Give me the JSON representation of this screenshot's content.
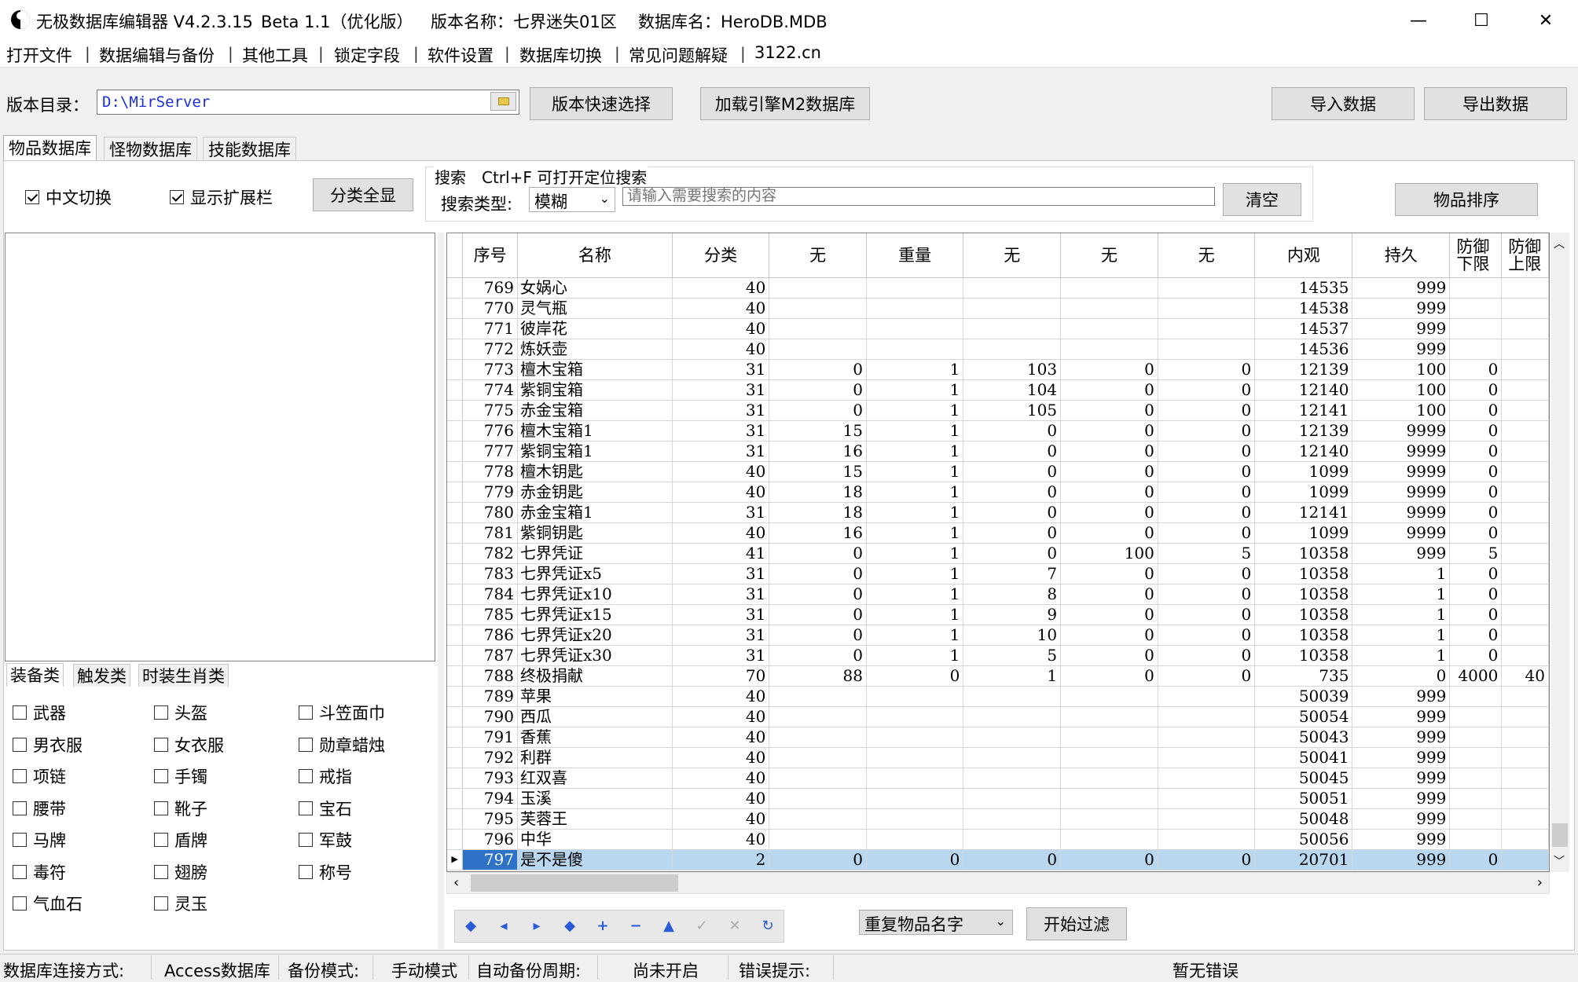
{
  "window": {
    "title": "无极数据库编辑器 V4.2.3.15",
    "beta": "Beta 1.1（优化版）",
    "version_name": "版本名称：七界迷失01区",
    "db_name": "数据库名：HeroDB.MDB",
    "min": "—",
    "max": "☐",
    "close": "✕"
  },
  "menu": [
    "打开文件",
    "数据编辑与备份",
    "其他工具",
    "锁定字段",
    "软件设置",
    "数据库切换",
    "常见问题解疑",
    "3122.cn"
  ],
  "toolbar": {
    "dir_label": "版本目录：",
    "dir_value": "D:\\MirServer",
    "quick_select": "版本快速选择",
    "load_m2": "加载引擎M2数据库",
    "import": "导入数据",
    "export": "导出数据"
  },
  "tabs": [
    "物品数据库",
    "怪物数据库",
    "技能数据库"
  ],
  "options": {
    "chinese_toggle": "中文切换",
    "show_ext": "显示扩展栏",
    "show_all": "分类全显",
    "search_title": "搜索　Ctrl+F 可打开定位搜索",
    "search_type_label": "搜索类型:",
    "search_type_value": "模糊",
    "search_placeholder": "请输入需要搜索的内容",
    "clear": "清空",
    "sort": "物品排序"
  },
  "subtabs": [
    "装备类",
    "触发类",
    "时装生肖类"
  ],
  "categories": [
    [
      "武器",
      "头盔",
      "斗笠面巾"
    ],
    [
      "男衣服",
      "女衣服",
      "勋章蜡烛"
    ],
    [
      "项链",
      "手镯",
      "戒指"
    ],
    [
      "腰带",
      "靴子",
      "宝石"
    ],
    [
      "马牌",
      "盾牌",
      "军鼓"
    ],
    [
      "毒符",
      "翅膀",
      "称号"
    ],
    [
      "气血石",
      "灵玉",
      ""
    ]
  ],
  "grid": {
    "columns": [
      "序号",
      "名称",
      "分类",
      "无",
      "重量",
      "无",
      "无",
      "无",
      "内观",
      "持久",
      "防御下限",
      "防御上限"
    ],
    "rows": [
      [
        "769",
        "女娲心",
        "40",
        "",
        "",
        "",
        "",
        "",
        "14535",
        "999",
        "",
        ""
      ],
      [
        "770",
        "灵气瓶",
        "40",
        "",
        "",
        "",
        "",
        "",
        "14538",
        "999",
        "",
        ""
      ],
      [
        "771",
        "彼岸花",
        "40",
        "",
        "",
        "",
        "",
        "",
        "14537",
        "999",
        "",
        ""
      ],
      [
        "772",
        "炼妖壶",
        "40",
        "",
        "",
        "",
        "",
        "",
        "14536",
        "999",
        "",
        ""
      ],
      [
        "773",
        "檀木宝箱",
        "31",
        "0",
        "1",
        "103",
        "0",
        "0",
        "12139",
        "100",
        "0",
        ""
      ],
      [
        "774",
        "紫铜宝箱",
        "31",
        "0",
        "1",
        "104",
        "0",
        "0",
        "12140",
        "100",
        "0",
        ""
      ],
      [
        "775",
        "赤金宝箱",
        "31",
        "0",
        "1",
        "105",
        "0",
        "0",
        "12141",
        "100",
        "0",
        ""
      ],
      [
        "776",
        "檀木宝箱1",
        "31",
        "15",
        "1",
        "0",
        "0",
        "0",
        "12139",
        "9999",
        "0",
        ""
      ],
      [
        "777",
        "紫铜宝箱1",
        "31",
        "16",
        "1",
        "0",
        "0",
        "0",
        "12140",
        "9999",
        "0",
        ""
      ],
      [
        "778",
        "檀木钥匙",
        "40",
        "15",
        "1",
        "0",
        "0",
        "0",
        "1099",
        "9999",
        "0",
        ""
      ],
      [
        "779",
        "赤金钥匙",
        "40",
        "18",
        "1",
        "0",
        "0",
        "0",
        "1099",
        "9999",
        "0",
        ""
      ],
      [
        "780",
        "赤金宝箱1",
        "31",
        "18",
        "1",
        "0",
        "0",
        "0",
        "12141",
        "9999",
        "0",
        ""
      ],
      [
        "781",
        "紫铜钥匙",
        "40",
        "16",
        "1",
        "0",
        "0",
        "0",
        "1099",
        "9999",
        "0",
        ""
      ],
      [
        "782",
        "七界凭证",
        "41",
        "0",
        "1",
        "0",
        "100",
        "5",
        "10358",
        "999",
        "5",
        ""
      ],
      [
        "783",
        "七界凭证x5",
        "31",
        "0",
        "1",
        "7",
        "0",
        "0",
        "10358",
        "1",
        "0",
        ""
      ],
      [
        "784",
        "七界凭证x10",
        "31",
        "0",
        "1",
        "8",
        "0",
        "0",
        "10358",
        "1",
        "0",
        ""
      ],
      [
        "785",
        "七界凭证x15",
        "31",
        "0",
        "1",
        "9",
        "0",
        "0",
        "10358",
        "1",
        "0",
        ""
      ],
      [
        "786",
        "七界凭证x20",
        "31",
        "0",
        "1",
        "10",
        "0",
        "0",
        "10358",
        "1",
        "0",
        ""
      ],
      [
        "787",
        "七界凭证x30",
        "31",
        "0",
        "1",
        "5",
        "0",
        "0",
        "10358",
        "1",
        "0",
        ""
      ],
      [
        "788",
        "终极捐献",
        "70",
        "88",
        "0",
        "1",
        "0",
        "0",
        "735",
        "0",
        "4000",
        "40"
      ],
      [
        "789",
        "苹果",
        "40",
        "",
        "",
        "",
        "",
        "",
        "50039",
        "999",
        "",
        ""
      ],
      [
        "790",
        "西瓜",
        "40",
        "",
        "",
        "",
        "",
        "",
        "50054",
        "999",
        "",
        ""
      ],
      [
        "791",
        "香蕉",
        "40",
        "",
        "",
        "",
        "",
        "",
        "50043",
        "999",
        "",
        ""
      ],
      [
        "792",
        "利群",
        "40",
        "",
        "",
        "",
        "",
        "",
        "50041",
        "999",
        "",
        ""
      ],
      [
        "793",
        "红双喜",
        "40",
        "",
        "",
        "",
        "",
        "",
        "50045",
        "999",
        "",
        ""
      ],
      [
        "794",
        "玉溪",
        "40",
        "",
        "",
        "",
        "",
        "",
        "50051",
        "999",
        "",
        ""
      ],
      [
        "795",
        "芙蓉王",
        "40",
        "",
        "",
        "",
        "",
        "",
        "50048",
        "999",
        "",
        ""
      ],
      [
        "796",
        "中华",
        "40",
        "",
        "",
        "",
        "",
        "",
        "50056",
        "999",
        "",
        ""
      ],
      [
        "797",
        "是不是傻",
        "2",
        "0",
        "0",
        "0",
        "0",
        "0",
        "20701",
        "999",
        "0",
        ""
      ]
    ]
  },
  "nav_icons": [
    "first-icon",
    "prev-icon",
    "next-icon",
    "last-icon",
    "add-icon",
    "delete-icon",
    "edit-icon",
    "post-icon",
    "cancel-icon",
    "refresh-icon"
  ],
  "filter": {
    "dup_select": "重复物品名字",
    "start": "开始过滤"
  },
  "status": {
    "conn_label": "数据库连接方式:",
    "conn_value": "Access数据库",
    "backup_label": "备份模式:",
    "backup_value": "手动模式",
    "auto_label": "自动备份周期:",
    "auto_value": "尚未开启",
    "err_label": "错误提示:",
    "err_value": "暂无错误"
  }
}
